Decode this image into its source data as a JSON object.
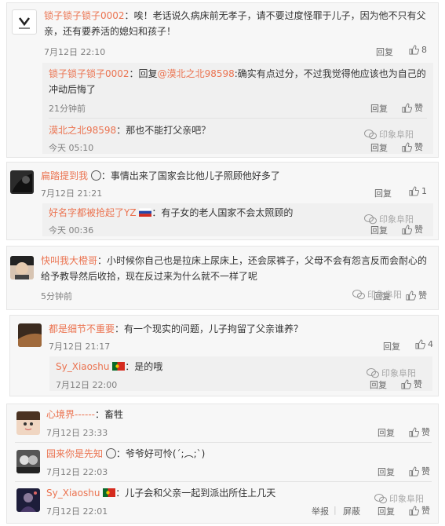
{
  "c1": {
    "user": "锁子锁子锁子0002",
    "sep": "：",
    "text": "唉！老话说久病床前无孝子，请不要过度怪罪于儿子，因为他不只有父亲，还有要养活的媳妇和孩子！",
    "time": "7月12日 22:10",
    "reply": "回复",
    "likes": "8"
  },
  "c1r1": {
    "user": "锁子锁子锁子0002",
    "mid": "：回复",
    "mention": "@漠北之北98598",
    "text": ":确实有点过分，不过我觉得他应该也为自己的冲动后悔了",
    "time": "21分钟前",
    "reply": "回复",
    "like": "赞"
  },
  "c1r2": {
    "user": "漠北之北98598",
    "sep": "：",
    "text": "那也不能打父亲吧？",
    "time": "今天 05:10",
    "reply": "回复",
    "like": "赞"
  },
  "c2": {
    "user": "扁踏提到我",
    "sep": "：",
    "text": "事情出来了国家会比他儿子照顾他好多了",
    "time": "7月12日 21:21",
    "reply": "回复",
    "likes": "1"
  },
  "c2r1": {
    "user": "好名字都被抢起了YZ",
    "sep": "：",
    "text": "有子女的老人国家不会太照顾的",
    "time": "今天 00:36",
    "reply": "回复",
    "like": "赞"
  },
  "c3": {
    "user": "快叫我大橙哥",
    "sep": "：",
    "text": "小时候你自己也是拉床上尿床上，还会尿裤子，父母不会有怨言反而会耐心的给予教导然后收拾，现在反过来为什么就不一样了呢",
    "time": "5分钟前",
    "reply": "回复",
    "like": "赞"
  },
  "c4": {
    "user": "都是细节不重要",
    "sep": "：",
    "text": "有一个现实的问题，儿子拘留了父亲谁养？",
    "time": "7月12日 21:17",
    "reply": "回复",
    "likes": "4"
  },
  "c4r1": {
    "user": "Sy_Xiaoshu",
    "sep": "：",
    "text": "是的哦",
    "time": "7月12日 22:00",
    "reply": "回复",
    "like": "赞"
  },
  "c5": {
    "user": "心境界------",
    "sep": "：",
    "text": "畜牲",
    "time": "7月12日 23:33",
    "reply": "回复",
    "like": "赞"
  },
  "c6": {
    "user": "园来你是先知",
    "sep": "：",
    "text": "爷爷好可怜(´;︵;`)",
    "time": "7月12日 22:03",
    "reply": "回复",
    "like": "赞"
  },
  "c7": {
    "user": "Sy_Xiaoshu",
    "sep": "：",
    "text": "儿子会和父亲一起到派出所住上几天",
    "time": "7月12日 22:01",
    "report": "举报",
    "block": "屏蔽",
    "reply": "回复",
    "like": "赞"
  },
  "watermark": "印象阜阳",
  "colors": {
    "username": "#eb7350",
    "card_bg": "#f7f7f7",
    "reply_bg": "#f0f0f0",
    "meta": "#808080"
  }
}
